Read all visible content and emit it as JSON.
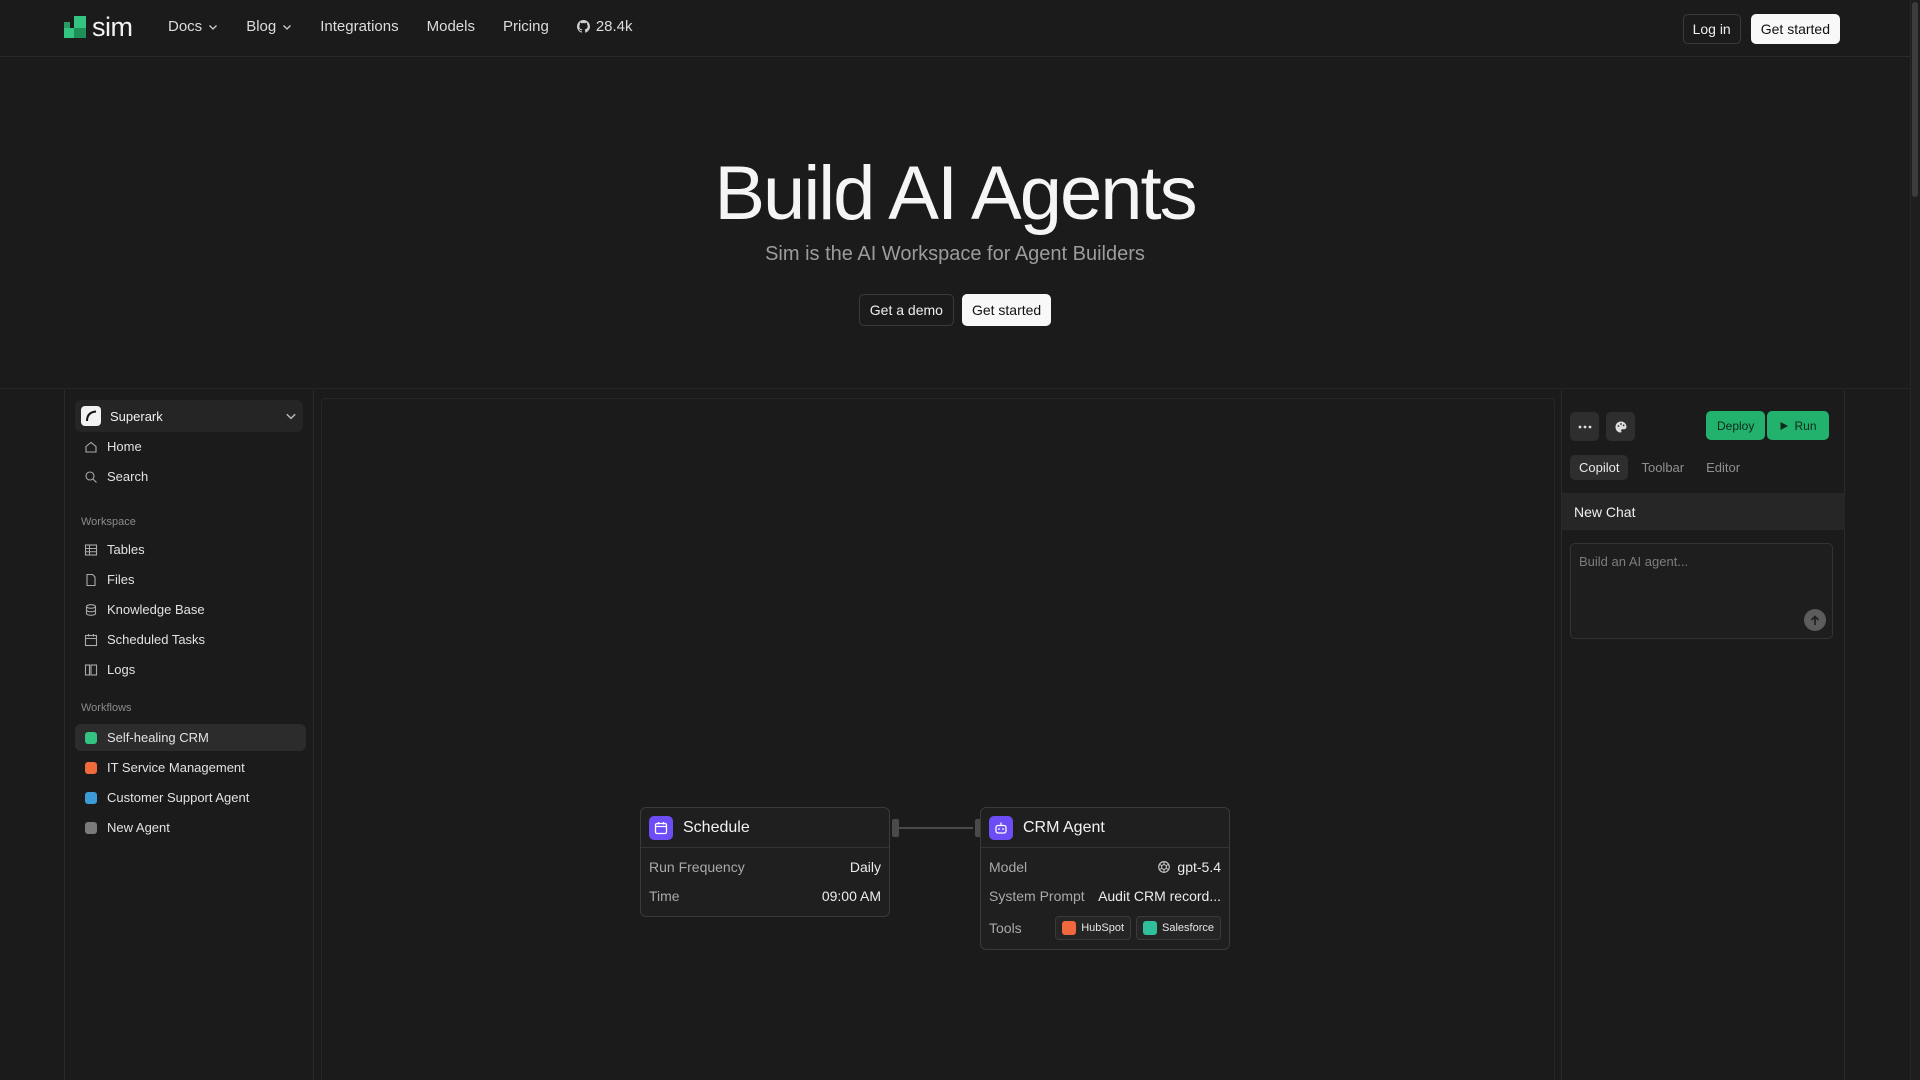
{
  "brand": {
    "name": "sim",
    "accent": "#33c481"
  },
  "nav": {
    "links": [
      {
        "label": "Docs",
        "dropdown": true
      },
      {
        "label": "Blog",
        "dropdown": true
      },
      {
        "label": "Integrations"
      },
      {
        "label": "Models"
      },
      {
        "label": "Pricing"
      }
    ],
    "github_stars": "28.4k",
    "login_label": "Log in",
    "get_started_label": "Get started"
  },
  "hero": {
    "title": "Build AI Agents",
    "subtitle": "Sim is the AI Workspace for Agent Builders",
    "demo_label": "Get a demo",
    "cta_label": "Get started"
  },
  "sidebar": {
    "workspace_name": "Superark",
    "top_items": [
      {
        "label": "Home",
        "icon": "home-icon"
      },
      {
        "label": "Search",
        "icon": "search-icon"
      }
    ],
    "workspace_section": "Workspace",
    "workspace_items": [
      {
        "label": "Tables",
        "icon": "table-icon"
      },
      {
        "label": "Files",
        "icon": "file-icon"
      },
      {
        "label": "Knowledge Base",
        "icon": "database-icon"
      },
      {
        "label": "Scheduled Tasks",
        "icon": "calendar-icon"
      },
      {
        "label": "Logs",
        "icon": "logs-icon"
      }
    ],
    "workflows_section": "Workflows",
    "workflows": [
      {
        "label": "Self-healing CRM",
        "color": "#33c481",
        "active": true
      },
      {
        "label": "IT Service Management",
        "color": "#f06a3c"
      },
      {
        "label": "Customer Support Agent",
        "color": "#3b9cd8"
      },
      {
        "label": "New Agent",
        "color": "#7a7a7a"
      }
    ]
  },
  "canvas": {
    "schedule_node": {
      "title": "Schedule",
      "rows": [
        {
          "key": "Run Frequency",
          "value": "Daily"
        },
        {
          "key": "Time",
          "value": "09:00 AM"
        }
      ]
    },
    "agent_node": {
      "title": "CRM Agent",
      "model_key": "Model",
      "model_value": "gpt-5.4",
      "prompt_key": "System Prompt",
      "prompt_value": "Audit CRM record...",
      "tools_key": "Tools",
      "tools": [
        {
          "label": "HubSpot",
          "color": "#f0683c"
        },
        {
          "label": "Salesforce",
          "color": "#2fbf9a"
        }
      ]
    }
  },
  "panel": {
    "deploy_label": "Deploy",
    "run_label": "Run",
    "tabs": [
      {
        "label": "Copilot",
        "active": true
      },
      {
        "label": "Toolbar"
      },
      {
        "label": "Editor"
      }
    ],
    "chat_title": "New Chat",
    "chat_placeholder": "Build an AI agent..."
  }
}
